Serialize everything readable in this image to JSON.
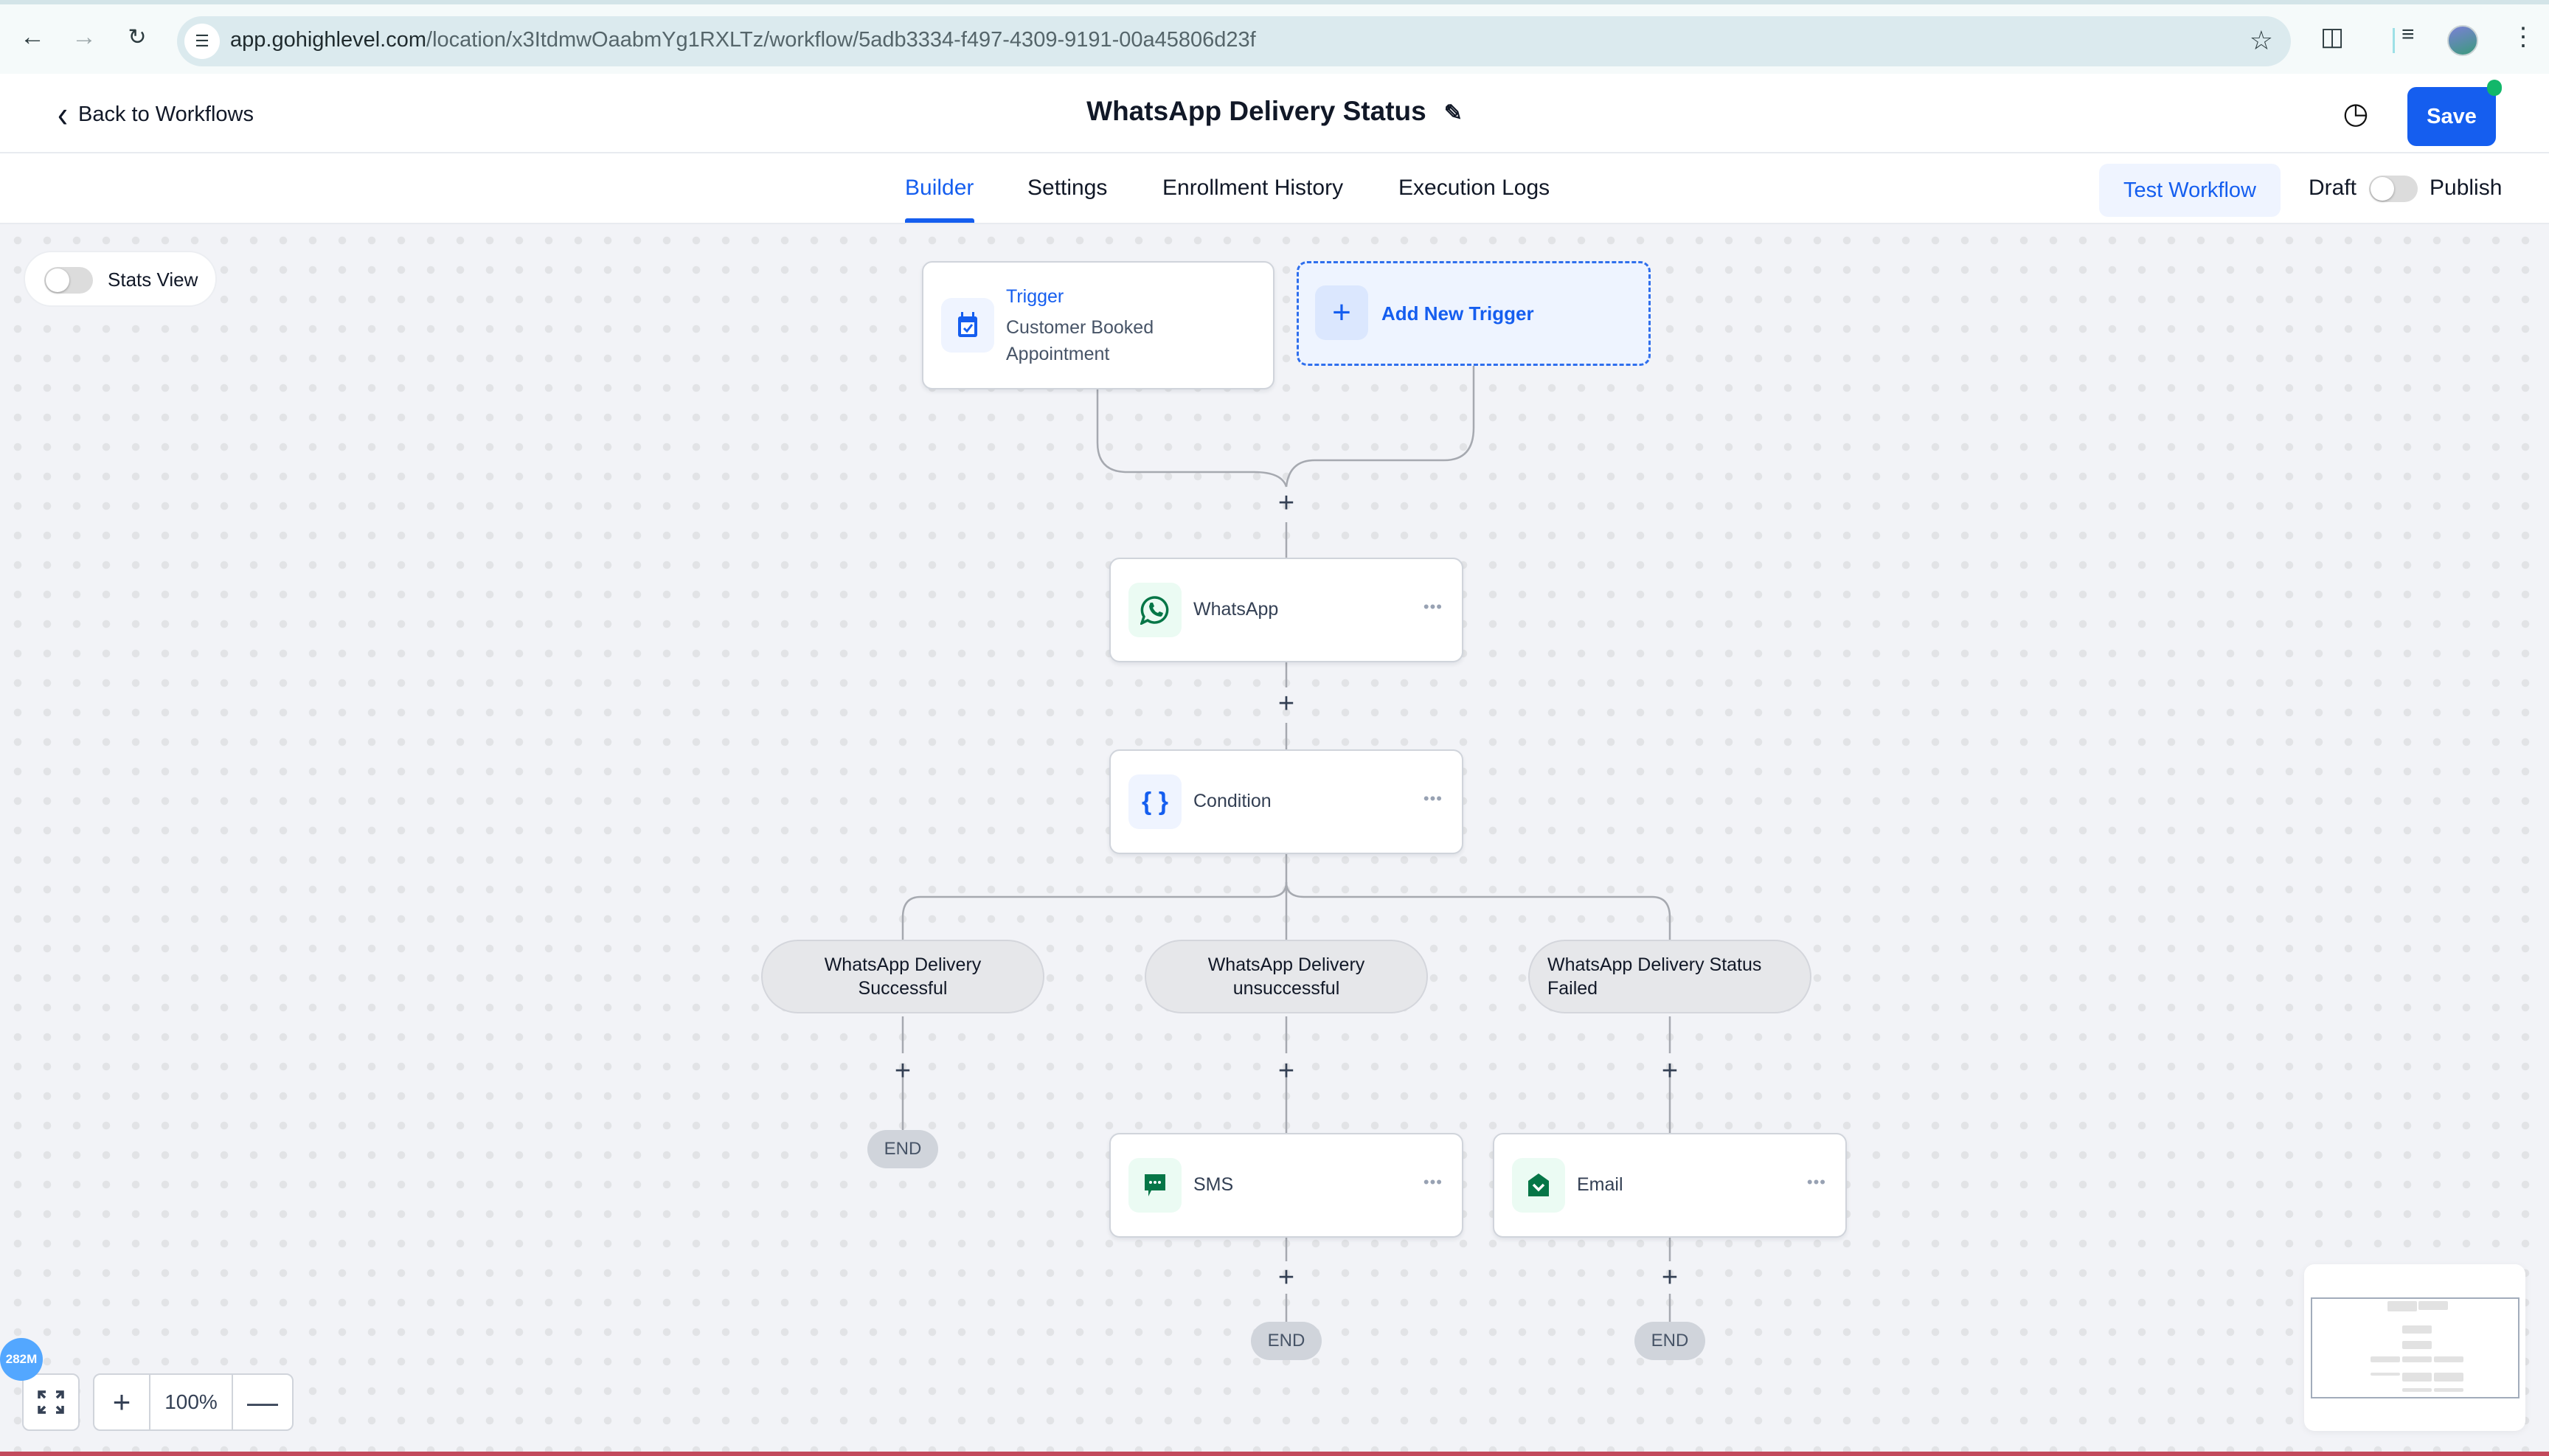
{
  "browser": {
    "url_host": "app.gohighlevel.com",
    "url_path": "/location/x3ItdmwOaabmYg1RXLTz/workflow/5adb3334-f497-4309-9191-00a45806d23f",
    "icons": [
      "back-arrow-icon",
      "forward-arrow-icon",
      "reload-icon",
      "site-settings-icon",
      "bookmark-star-icon",
      "extensions-icon",
      "media-controls-icon",
      "profile-avatar",
      "more-menu-icon"
    ]
  },
  "header": {
    "back_label": "Back to Workflows",
    "title": "WhatsApp Delivery Status",
    "save_label": "Save"
  },
  "tabs": {
    "items": [
      {
        "label": "Builder",
        "active": true
      },
      {
        "label": "Settings",
        "active": false
      },
      {
        "label": "Enrollment History",
        "active": false
      },
      {
        "label": "Execution Logs",
        "active": false
      }
    ],
    "test_workflow_label": "Test Workflow",
    "draft_label": "Draft",
    "publish_label": "Publish",
    "publish_toggle_on": false
  },
  "canvas": {
    "stats_view_label": "Stats View",
    "stats_view_on": false,
    "trigger": {
      "title": "Trigger",
      "subtitle": "Customer Booked Appointment"
    },
    "add_trigger_label": "Add New Trigger",
    "actions": {
      "whatsapp": {
        "label": "WhatsApp"
      },
      "condition": {
        "label": "Condition"
      },
      "sms": {
        "label": "SMS"
      },
      "email": {
        "label": "Email"
      }
    },
    "branches": [
      {
        "label": "WhatsApp Delivery Successful"
      },
      {
        "label": "WhatsApp Delivery unsuccessful"
      },
      {
        "label": "WhatsApp Delivery Status Failed"
      }
    ],
    "end_label": "END",
    "more_label": "•••",
    "plus_label": "+"
  },
  "controls": {
    "memory_badge": "282M",
    "zoom_level": "100%",
    "zoom_in_label": "+",
    "zoom_out_label": "—"
  },
  "colors": {
    "accent": "#155eef",
    "whatsapp_green": "#067647",
    "canvas_bg": "#f2f3f7"
  }
}
